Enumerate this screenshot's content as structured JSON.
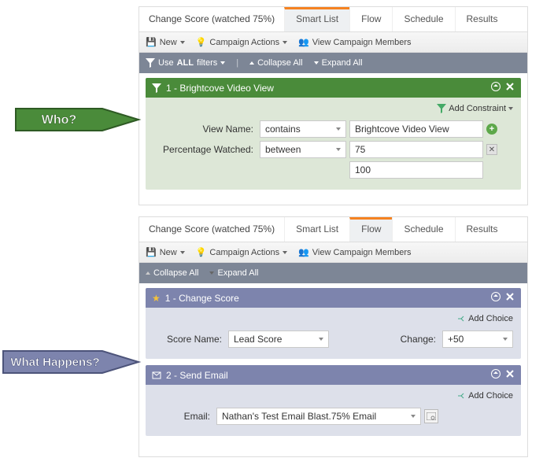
{
  "top": {
    "title": "Change Score (watched 75%)",
    "tabs": [
      "Smart List",
      "Flow",
      "Schedule",
      "Results"
    ],
    "activeTab": "Smart List",
    "toolbar": {
      "new": "New",
      "actions": "Campaign Actions",
      "members": "View Campaign Members"
    },
    "filterbar": {
      "use": "Use",
      "all": "ALL",
      "filters": "filters",
      "collapse": "Collapse All",
      "expand": "Expand All"
    },
    "card": {
      "title": "1 - Brightcove Video View",
      "addConstraint": "Add Constraint",
      "rows": {
        "viewName": {
          "label": "View Name:",
          "op": "contains",
          "val": "Brightcove Video View"
        },
        "pct": {
          "label": "Percentage Watched:",
          "op": "between",
          "v1": "75",
          "v2": "100"
        }
      }
    }
  },
  "bottom": {
    "title": "Change Score (watched 75%)",
    "tabs": [
      "Smart List",
      "Flow",
      "Schedule",
      "Results"
    ],
    "activeTab": "Flow",
    "toolbar": {
      "new": "New",
      "actions": "Campaign Actions",
      "members": "View Campaign Members"
    },
    "filterbar": {
      "collapse": "Collapse All",
      "expand": "Expand All"
    },
    "card1": {
      "title": "1 - Change Score",
      "addChoice": "Add Choice",
      "scoreLabel": "Score Name:",
      "scoreVal": "Lead Score",
      "changeLabel": "Change:",
      "changeVal": "+50"
    },
    "card2": {
      "title": "2 - Send Email",
      "addChoice": "Add Choice",
      "emailLabel": "Email:",
      "emailVal": "Nathan's Test Email Blast.75% Email"
    }
  },
  "arrows": {
    "who": "Who?",
    "what": "What Happens?"
  }
}
